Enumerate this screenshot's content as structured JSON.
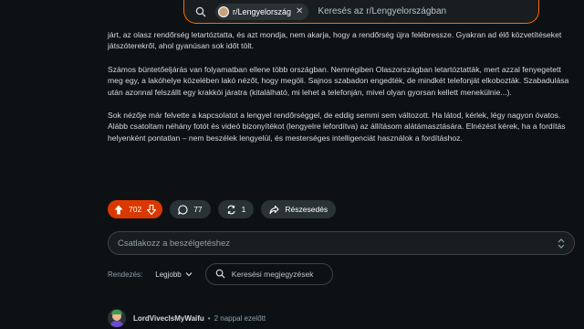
{
  "search": {
    "community_chip": "r/Lengyelország",
    "placeholder": "Keresés az r/Lengyelországban"
  },
  "post": {
    "paragraphs": [
      "járt, az olasz rendőrség letartóztatta, és azt mondja, nem akarja, hogy a rendőrség újra felébressze. Gyakran ad élő közvetítéseket játszóterekről, ahol gyanúsan sok időt tölt.",
      "Számos büntetőeljárás van folyamatban ellene több országban. Nemrégiben Olaszországban letartóztatták, mert azzal fenyegetett meg egy, a lakóhelye közelében lakó nézőt, hogy megöli. Sajnos szabadon engedték, de mindkét telefonját elkobozták. Szabadulása után azonnal felszállt egy krakkói járatra (kitalálható, mi lehet a telefonján, mivel olyan gyorsan kellett menekülnie...).",
      "Sok nézője már felvette a kapcsolatot a lengyel rendőrséggel, de eddig semmi sem változott. Ha látod, kérlek, légy nagyon óvatos. Alább csatoltam néhány fotót és videó bizonyítékot (lengyelre lefordítva) az állításom alátámasztására. Elnézést kérek, ha a fordítás helyenként pontatlan – nem beszélek lengyelül, és mesterséges intelligenciát használok a fordításhoz."
    ]
  },
  "actions": {
    "upvotes": "702",
    "comments": "77",
    "crossposts": "1",
    "share_label": "Részesedés"
  },
  "comment_box": {
    "placeholder": "Csatlakozz a beszélgetéshez"
  },
  "sort": {
    "label": "Rendezés:",
    "value": "Legjobb",
    "search_placeholder": "Keresési megjegyzések"
  },
  "first_comment": {
    "author": "LordViveclsMyWaifu",
    "separator": "•",
    "time": "2 nappal ezelőtt"
  },
  "colors": {
    "accent": "#ff6a00",
    "vote_bg": "#d93900",
    "background": "#0e1113"
  }
}
